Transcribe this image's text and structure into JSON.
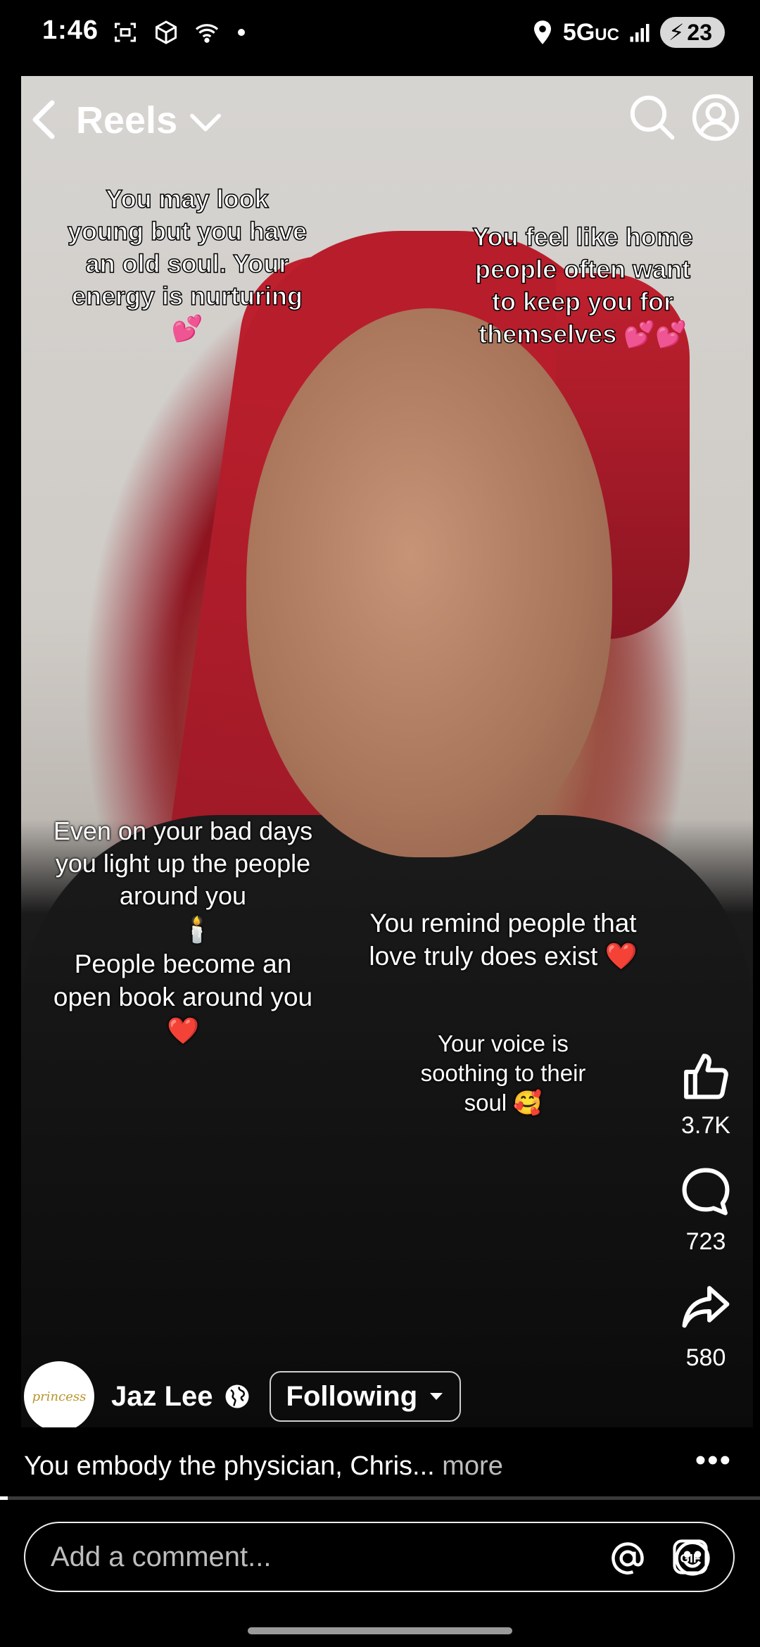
{
  "status": {
    "time": "1:46",
    "network": "5G",
    "network_suffix": "UC",
    "battery": "23"
  },
  "nav": {
    "title": "Reels"
  },
  "overlay": {
    "top_left": "You may look young but you have an old soul. Your energy is nurturing 💕",
    "top_right": "You feel like home people often want to keep you for themselves 💕💕",
    "mid_left_1": "Even on your bad days you light up the people around you",
    "mid_left_emoji": "🕯️",
    "mid_left_2": "People become an open book around you ❤️",
    "mid_right_1": "You remind people that love truly does exist ❤️",
    "mid_right_2": "Your voice is soothing to their soul 🥰"
  },
  "actions": {
    "likes": "3.7K",
    "comments": "723",
    "shares": "580"
  },
  "author": {
    "name": "Jaz Lee",
    "follow_label": "Following",
    "avatar_text": "princess"
  },
  "caption": {
    "text": "You embody the physician, Chris...",
    "more": "more",
    "progress": 0.01
  },
  "comment": {
    "placeholder": "Add a comment..."
  },
  "icons": [
    "camera-icon",
    "box-icon",
    "wifi-icon",
    "location-icon",
    "signal-icon",
    "back-icon",
    "chevron-down-icon",
    "search-icon",
    "profile-icon",
    "like-icon",
    "comment-icon",
    "share-icon",
    "globe-icon",
    "more-icon",
    "mention-icon",
    "emoji-icon",
    "gif-icon"
  ]
}
